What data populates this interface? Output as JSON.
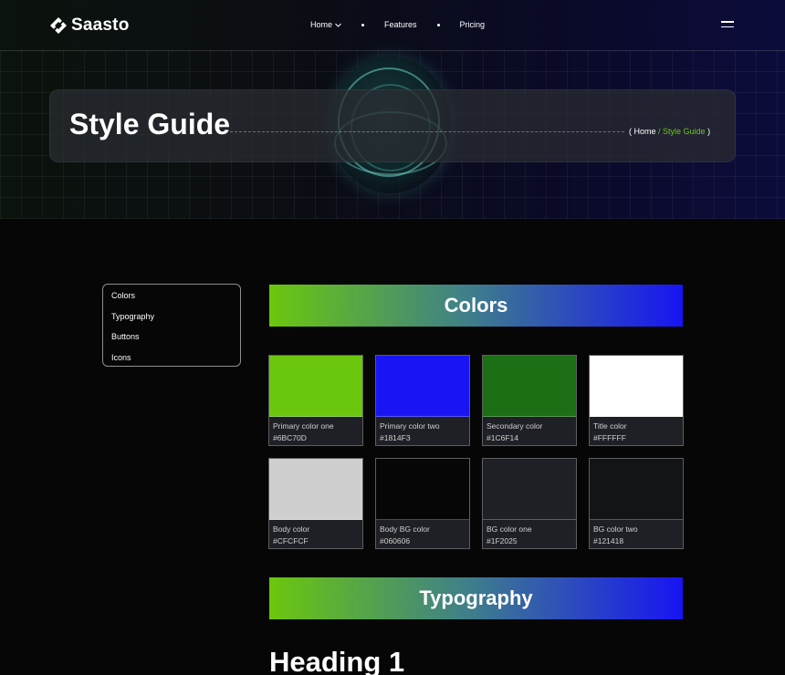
{
  "brand": {
    "name": "Saasto"
  },
  "nav": {
    "items": [
      {
        "label": "Home",
        "has_dropdown": true
      },
      {
        "label": "Features"
      },
      {
        "label": "Pricing"
      }
    ],
    "menu_icon": "hamburger-menu-icon"
  },
  "hero": {
    "title": "Style Guide",
    "breadcrumb": {
      "open": "( ",
      "home": "Home",
      "separator": " / ",
      "current": "Style Guide",
      "close": " )"
    }
  },
  "sidebar": {
    "items": [
      {
        "label": "Colors"
      },
      {
        "label": "Typography"
      },
      {
        "label": "Buttons"
      },
      {
        "label": "Icons"
      }
    ]
  },
  "sections": {
    "colors_title": "Colors",
    "typography_title": "Typography"
  },
  "colors": [
    {
      "name": "Primary color one",
      "hex": "#6BC70D"
    },
    {
      "name": "Primary color two",
      "hex": "#1814F3"
    },
    {
      "name": "Secondary color",
      "hex": "#1C6F14"
    },
    {
      "name": "Title color",
      "hex": "#FFFFFF"
    },
    {
      "name": "Body color",
      "hex": "#CFCFCF"
    },
    {
      "name": "Body BG color",
      "hex": "#060606"
    },
    {
      "name": "BG color one",
      "hex": "#1F2025"
    },
    {
      "name": "BG color two",
      "hex": "#121418"
    }
  ],
  "typography": {
    "heading_1": "Heading 1"
  },
  "theme": {
    "accent": "#6BC70D",
    "accent_two": "#1814F3",
    "page_bg": "#060606"
  }
}
